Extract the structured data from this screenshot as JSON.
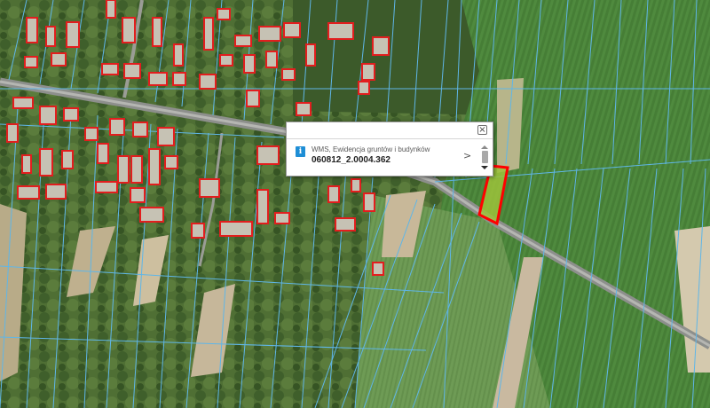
{
  "popup": {
    "layer_name": "WMS, Ewidencja gruntów i budynków",
    "parcel_id": "060812_2.0004.362",
    "close_symbol": "×",
    "next_symbol": ">",
    "info_symbol": "i"
  },
  "map": {
    "parcel_line_color": "#5fb6e8",
    "building_outline_color": "#e21e1e",
    "highlight_color": "#ff0000",
    "icons": [
      "info-icon",
      "close-icon",
      "chevron-right-icon",
      "scroll-up-icon",
      "scroll-down-icon"
    ]
  }
}
